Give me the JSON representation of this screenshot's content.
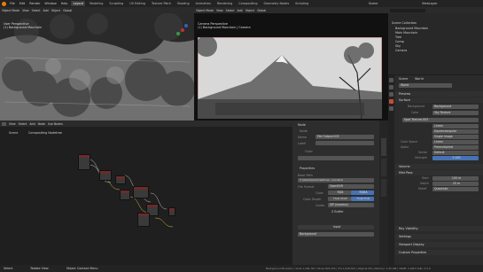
{
  "topbar": {
    "menus": [
      "File",
      "Edit",
      "Render",
      "Window",
      "Help"
    ],
    "workspaces": [
      "Layout",
      "Modeling",
      "Sculpting",
      "UV Editing",
      "Texture Paint",
      "Shading",
      "Animation",
      "Rendering",
      "Compositing",
      "Geometry Nodes",
      "Scripting"
    ],
    "active_workspace": "Layout",
    "scene_label": "Scene",
    "view_layer_label": "ViewLayer"
  },
  "viewport_left": {
    "header": [
      "Object Mode",
      "View",
      "Select",
      "Add",
      "Object",
      "Global"
    ],
    "overlay_title": "User Perspective",
    "overlay_sub": "(1) Background Mountain"
  },
  "viewport_camera": {
    "header": [
      "Object Mode",
      "View",
      "Select",
      "Add",
      "Object",
      "Global"
    ],
    "overlay_title": "Camera Perspective",
    "overlay_sub": "(1) Background Mountain | Camera"
  },
  "outliner": {
    "header": "Scene Collection",
    "items": [
      {
        "name": "Scene Collection"
      },
      {
        "name": "Background Mountain"
      },
      {
        "name": "Main Mountain"
      },
      {
        "name": "Tree"
      },
      {
        "name": "Comp"
      },
      {
        "name": "Sky"
      },
      {
        "name": "Camera"
      }
    ]
  },
  "node_editor": {
    "header": [
      "View",
      "Select",
      "Add",
      "Node",
      "Use Nodes"
    ],
    "breadcrumb": [
      "Scene",
      "Compositing Nodetree"
    ]
  },
  "nprops": {
    "title": "Node",
    "tab_label": "Node",
    "name_label": "Name",
    "name_value": "File Output.003",
    "label_label": "Label",
    "color_label": "Color",
    "properties_label": "Properties",
    "base_path_label": "Base Path",
    "base_path_value": "C:\\Users\\mac\\OneDrive\\...\\renders\\",
    "file_format_label": "File Format",
    "file_format_value": "OpenEXR",
    "color_label2": "Color",
    "color_opts": [
      "RGB",
      "RGBA"
    ],
    "color_depth_label": "Color Depth",
    "depth_opts": [
      "Float (Half)",
      "Float (Full)"
    ],
    "codec_label": "Codec",
    "codec_value": "ZIP (lossless)",
    "zbuffer_label": "Z Buffer",
    "input_header": "Input",
    "input_value": "Background"
  },
  "props": {
    "world_name": "World",
    "scene_label": "Scene",
    "world_label": "World",
    "preview_label": "Preview",
    "surface_label": "Surface",
    "surface_value": "Background",
    "color_label": "Color",
    "color_value": "Sky Texture",
    "node_label": "Spot Texture.003",
    "linear_label": "Linear",
    "equi_label": "Equirectangular",
    "single_image_label": "Single Image",
    "colorspace_label": "Color Space",
    "colorspace_value": "Linear",
    "alpha_label": "Alpha",
    "alpha_value": "Premultiplied",
    "vector_label": "Vector",
    "vector_value": "Default",
    "strength_label": "Strength",
    "strength_value": "1.000",
    "volume_label": "Volume",
    "mist_label": "Mist Pass",
    "start_label": "Start",
    "start_value": "100 m",
    "depth_label": "Depth",
    "depth_value": "25 m",
    "falloff_label": "Falloff",
    "falloff_value": "Quadratic",
    "ray_label": "Ray Visibility",
    "settings_label": "Settings",
    "viewport_label": "Viewport Display",
    "custom_label": "Custom Properties"
  },
  "statusbar": {
    "left": [
      "Select",
      "Rotate View",
      "Object Context Menu"
    ],
    "right": "Background Mountain | Verts 1,190,787 | Faces 879,153 | Tris 1,618,524 | Objects 0/6 | Memory: 1.43 GiB | VRAM: 2.9/8.0 GiB | 3.3.0"
  },
  "colors": {
    "accent": "#4772b3",
    "node_header_red": "#6b2b2b",
    "node_header_green": "#3b6b3b"
  }
}
